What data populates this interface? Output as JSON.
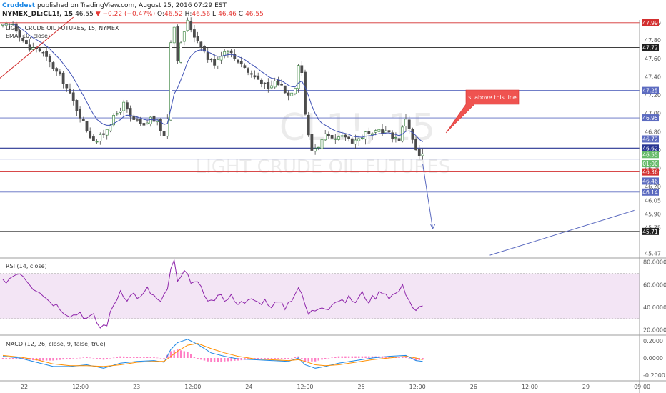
{
  "header": {
    "author": "Cruddest",
    "published": " published on TradingView.com, August 25, 2016 07:29 EST",
    "symbol": "NYMEX_DL:CL1!, 15",
    "last": "46.55",
    "change": "−0.22 (−0.47%)",
    "ohlc": {
      "o_label": "O:",
      "o": "46.52",
      "h_label": "H:",
      "h": "46.56",
      "l_label": "L:",
      "l": "46.46",
      "c_label": "C:",
      "c": "46.55"
    }
  },
  "legend": {
    "title": "LIGHT CRUDE OIL FUTURES, 15, NYMEX",
    "ema": "EMA (10, close)"
  },
  "watermark": {
    "symbol": "CL1!, 15",
    "name": "LIGHT CRUDE OIL FUTURES"
  },
  "annotation": {
    "note": "sl above this line"
  },
  "colors": {
    "candle": "#4c4c4c",
    "candle_up": "#2e7d32",
    "ema": "#3f51b5",
    "rsi": "#8e24aa",
    "rsi_band": "#f3e5f5",
    "macd": "#1e88e5",
    "signal": "#ff8f00",
    "hist": "#ff1493",
    "red_line": "#d32f2f",
    "blue_line": "#5c6bc0",
    "note_bg": "#ef5350"
  },
  "chart_data": [
    {
      "type": "candlestick",
      "title": "LIGHT CRUDE OIL FUTURES, 15, NYMEX",
      "x_ticks": [
        "22",
        "12:00",
        "23",
        "12:00",
        "24",
        "12:00",
        "25",
        "12:00",
        "26",
        "12:00",
        "29",
        "09:00"
      ],
      "y_ticks": [
        "47.99",
        "47.80",
        "47.60",
        "47.40",
        "47.20",
        "47.00",
        "46.80",
        "46.60",
        "46.40",
        "46.20",
        "46.05",
        "45.90",
        "45.75",
        "45.47"
      ],
      "ylim": [
        45.42,
        48.02
      ],
      "price_points": [
        [
          0,
          47.95
        ],
        [
          3,
          47.98
        ],
        [
          6,
          47.8
        ],
        [
          8,
          47.7
        ],
        [
          10,
          47.72
        ],
        [
          12,
          47.65
        ],
        [
          14,
          47.55
        ],
        [
          16,
          47.45
        ],
        [
          18,
          47.35
        ],
        [
          20,
          47.2
        ],
        [
          22,
          47.05
        ],
        [
          24,
          46.9
        ],
        [
          26,
          46.75
        ],
        [
          28,
          46.7
        ],
        [
          30,
          46.78
        ],
        [
          32,
          46.9
        ],
        [
          34,
          47.0
        ],
        [
          36,
          47.1
        ],
        [
          38,
          46.95
        ],
        [
          40,
          46.9
        ],
        [
          42,
          46.85
        ],
        [
          44,
          46.95
        ],
        [
          46,
          46.9
        ],
        [
          48,
          46.75
        ],
        [
          49,
          46.95
        ],
        [
          50,
          47.8
        ],
        [
          51,
          47.95
        ],
        [
          52,
          47.6
        ],
        [
          53,
          47.75
        ],
        [
          54,
          47.9
        ],
        [
          55,
          48.0
        ],
        [
          57,
          47.85
        ],
        [
          59,
          47.75
        ],
        [
          61,
          47.6
        ],
        [
          63,
          47.55
        ],
        [
          65,
          47.65
        ],
        [
          67,
          47.7
        ],
        [
          69,
          47.6
        ],
        [
          71,
          47.55
        ],
        [
          73,
          47.45
        ],
        [
          75,
          47.4
        ],
        [
          77,
          47.35
        ],
        [
          79,
          47.25
        ],
        [
          81,
          47.35
        ],
        [
          83,
          47.3
        ],
        [
          85,
          47.2
        ],
        [
          87,
          47.3
        ],
        [
          88,
          47.55
        ],
        [
          89,
          47.45
        ],
        [
          90,
          47.0
        ],
        [
          91,
          46.75
        ],
        [
          92,
          46.6
        ],
        [
          94,
          46.65
        ],
        [
          96,
          46.75
        ],
        [
          98,
          46.7
        ],
        [
          100,
          46.72
        ],
        [
          102,
          46.75
        ],
        [
          104,
          46.7
        ],
        [
          106,
          46.72
        ],
        [
          108,
          46.78
        ],
        [
          110,
          46.75
        ],
        [
          112,
          46.82
        ],
        [
          114,
          46.8
        ],
        [
          116,
          46.75
        ],
        [
          118,
          46.72
        ],
        [
          120,
          46.95
        ],
        [
          121,
          46.85
        ],
        [
          122,
          46.7
        ],
        [
          123,
          46.6
        ],
        [
          124,
          46.52
        ],
        [
          125,
          46.55
        ]
      ],
      "ema_label": "EMA (10, close)",
      "horizontal_levels": [
        {
          "value": 47.99,
          "color": "red"
        },
        {
          "value": 47.72,
          "color": "black",
          "label": "47.72"
        },
        {
          "value": 47.25,
          "color": "blue",
          "label": "47.25"
        },
        {
          "value": 46.95,
          "color": "blue",
          "label": "46.95"
        },
        {
          "value": 46.72,
          "color": "blue",
          "label": "46.72"
        },
        {
          "value": 46.62,
          "color": "navy",
          "label": "46.62"
        },
        {
          "value": 46.5,
          "color": "blue"
        },
        {
          "value": 46.36,
          "color": "red",
          "label": "46.36"
        },
        {
          "value": 46.14,
          "color": "blue",
          "label": "46.14"
        },
        {
          "value": 45.71,
          "color": "black",
          "label": "45.71"
        }
      ],
      "price_tags": [
        {
          "value": 46.55,
          "label": "46.55",
          "color": "#66bb6a"
        },
        {
          "value": 46.45,
          "label": "01:00",
          "color": "#66bb6a"
        },
        {
          "value": 46.26,
          "label": "46.46",
          "color": "#5c6bc0"
        }
      ],
      "forecast": {
        "from": [
          125,
          46.45
        ],
        "to": [
          128,
          45.74
        ]
      },
      "trend_lines": [
        {
          "from": [
            -2,
            47.35
          ],
          "to": [
            21,
            48.05
          ]
        },
        {
          "from": [
            145,
            45.45
          ],
          "to": [
            188,
            45.94
          ]
        }
      ]
    },
    {
      "type": "line",
      "title": "RSI (14, close)",
      "y_ticks": [
        "80.0000",
        "60.0000",
        "40.0000",
        "20.0000"
      ],
      "ylim": [
        16,
        83
      ],
      "band": [
        30,
        70
      ],
      "values": [
        [
          0,
          62
        ],
        [
          3,
          68
        ],
        [
          5,
          72
        ],
        [
          7,
          65
        ],
        [
          9,
          58
        ],
        [
          11,
          55
        ],
        [
          13,
          48
        ],
        [
          15,
          44
        ],
        [
          17,
          40
        ],
        [
          19,
          35
        ],
        [
          21,
          33
        ],
        [
          23,
          36
        ],
        [
          25,
          30
        ],
        [
          27,
          32
        ],
        [
          29,
          22
        ],
        [
          31,
          26
        ],
        [
          33,
          42
        ],
        [
          35,
          55
        ],
        [
          37,
          48
        ],
        [
          39,
          52
        ],
        [
          41,
          48
        ],
        [
          43,
          56
        ],
        [
          45,
          50
        ],
        [
          47,
          44
        ],
        [
          49,
          55
        ],
        [
          50,
          75
        ],
        [
          51,
          80
        ],
        [
          52,
          62
        ],
        [
          54,
          70
        ],
        [
          56,
          64
        ],
        [
          58,
          60
        ],
        [
          60,
          52
        ],
        [
          62,
          45
        ],
        [
          64,
          50
        ],
        [
          66,
          48
        ],
        [
          68,
          50
        ],
        [
          70,
          45
        ],
        [
          72,
          42
        ],
        [
          74,
          48
        ],
        [
          76,
          44
        ],
        [
          78,
          46
        ],
        [
          80,
          42
        ],
        [
          82,
          44
        ],
        [
          84,
          40
        ],
        [
          86,
          48
        ],
        [
          88,
          58
        ],
        [
          90,
          42
        ],
        [
          91,
          34
        ],
        [
          93,
          38
        ],
        [
          95,
          42
        ],
        [
          97,
          40
        ],
        [
          99,
          46
        ],
        [
          101,
          44
        ],
        [
          103,
          48
        ],
        [
          105,
          45
        ],
        [
          107,
          52
        ],
        [
          109,
          46
        ],
        [
          111,
          50
        ],
        [
          113,
          55
        ],
        [
          115,
          50
        ],
        [
          117,
          52
        ],
        [
          119,
          58
        ],
        [
          121,
          48
        ],
        [
          122,
          40
        ],
        [
          123,
          38
        ],
        [
          125,
          40
        ]
      ]
    },
    {
      "type": "line",
      "title": "MACD (12, 26, close, 9, false, true)",
      "y_ticks": [
        "0.2000",
        "0.0000",
        "-0.2000"
      ],
      "ylim": [
        -0.26,
        0.26
      ],
      "macd": [
        [
          0,
          0.02
        ],
        [
          5,
          0.0
        ],
        [
          10,
          -0.05
        ],
        [
          15,
          -0.1
        ],
        [
          20,
          -0.1
        ],
        [
          25,
          -0.08
        ],
        [
          30,
          -0.12
        ],
        [
          35,
          -0.06
        ],
        [
          40,
          -0.04
        ],
        [
          45,
          -0.03
        ],
        [
          48,
          -0.05
        ],
        [
          50,
          0.1
        ],
        [
          52,
          0.18
        ],
        [
          55,
          0.22
        ],
        [
          58,
          0.16
        ],
        [
          62,
          0.06
        ],
        [
          66,
          0.02
        ],
        [
          70,
          -0.01
        ],
        [
          75,
          -0.02
        ],
        [
          80,
          -0.03
        ],
        [
          85,
          -0.04
        ],
        [
          88,
          0.0
        ],
        [
          90,
          -0.08
        ],
        [
          93,
          -0.12
        ],
        [
          96,
          -0.1
        ],
        [
          100,
          -0.06
        ],
        [
          105,
          -0.03
        ],
        [
          110,
          0.0
        ],
        [
          115,
          0.02
        ],
        [
          120,
          0.03
        ],
        [
          123,
          -0.03
        ],
        [
          125,
          -0.04
        ]
      ],
      "signal": [
        [
          0,
          0.03
        ],
        [
          5,
          0.01
        ],
        [
          10,
          -0.02
        ],
        [
          15,
          -0.07
        ],
        [
          20,
          -0.09
        ],
        [
          25,
          -0.09
        ],
        [
          30,
          -0.1
        ],
        [
          35,
          -0.08
        ],
        [
          40,
          -0.05
        ],
        [
          45,
          -0.04
        ],
        [
          48,
          -0.04
        ],
        [
          50,
          0.02
        ],
        [
          52,
          0.08
        ],
        [
          55,
          0.15
        ],
        [
          58,
          0.17
        ],
        [
          62,
          0.11
        ],
        [
          66,
          0.06
        ],
        [
          70,
          0.02
        ],
        [
          75,
          -0.01
        ],
        [
          80,
          -0.02
        ],
        [
          85,
          -0.03
        ],
        [
          88,
          -0.02
        ],
        [
          90,
          -0.04
        ],
        [
          93,
          -0.08
        ],
        [
          96,
          -0.09
        ],
        [
          100,
          -0.08
        ],
        [
          105,
          -0.05
        ],
        [
          110,
          -0.02
        ],
        [
          115,
          0.0
        ],
        [
          120,
          0.02
        ],
        [
          123,
          0.0
        ],
        [
          125,
          -0.02
        ]
      ]
    }
  ]
}
